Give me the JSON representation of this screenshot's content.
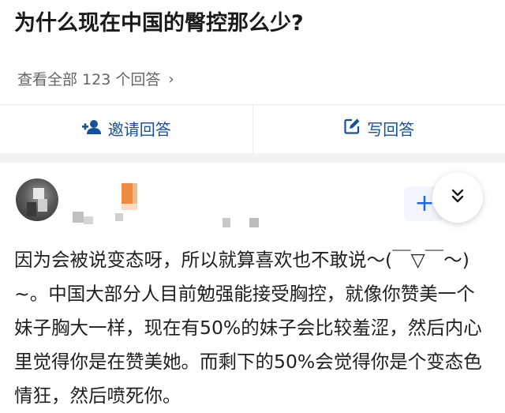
{
  "question": {
    "title": "为什么现在中国的臀控那么少?"
  },
  "answers_summary": {
    "view_all_label": "查看全部 123 个回答",
    "chevron": "›"
  },
  "actions": {
    "invite_label": "邀请回答",
    "write_label": "写回答"
  },
  "answer": {
    "follow_label": "+",
    "text": "因为会被说变态呀，所以就算喜欢也不敢说～(￣▽￣～)~。中国大部分人目前勉强能接受胸控，就像你赞美一个妹子胸大一样，现在有50%的妹子会比较羞涩，然后内心里觉得你是在赞美她。而剩下的50%会觉得你是个变态色情狂，然后喷死你。"
  },
  "colors": {
    "accent": "#175199",
    "follow_accent": "#1a6ae8",
    "muted": "#646464"
  },
  "icons": {
    "invite": "add-user-icon",
    "write": "edit-square-icon",
    "collapse": "double-chevron-down-icon"
  }
}
